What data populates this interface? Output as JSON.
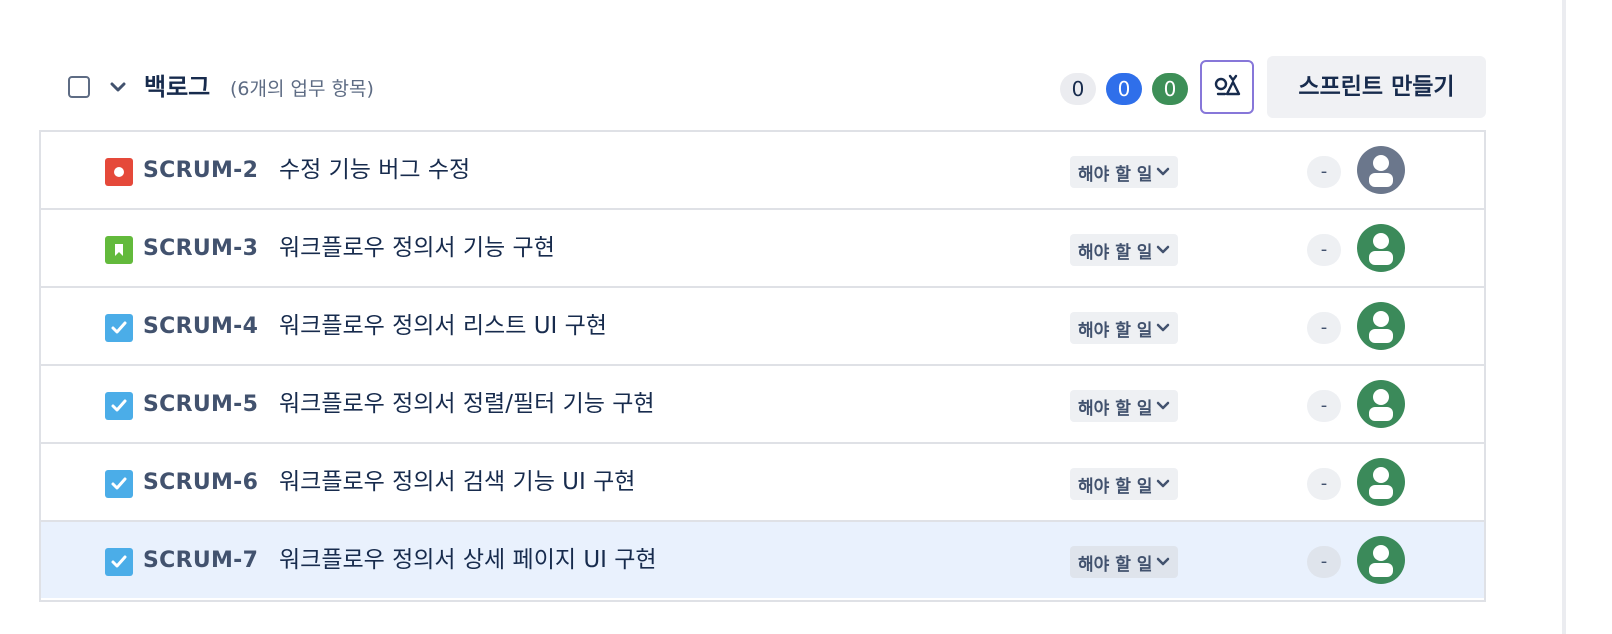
{
  "backlog": {
    "title": "백로그",
    "count_text": "(6개의 업무 항목)",
    "status_counts": {
      "todo": "0",
      "in_progress": "0",
      "done": "0"
    },
    "create_sprint_label": "스프린트 만들기"
  },
  "issues": [
    {
      "key": "SCRUM-2",
      "summary": "수정 기능 버그 수정",
      "type": "bug",
      "status": "해야 할 일",
      "estimate": "-",
      "assignee_color": "#6b778c"
    },
    {
      "key": "SCRUM-3",
      "summary": "워크플로우 정의서 기능 구현",
      "type": "story",
      "status": "해야 할 일",
      "estimate": "-",
      "assignee_color": "#3b8a5a"
    },
    {
      "key": "SCRUM-4",
      "summary": "워크플로우 정의서 리스트 UI 구현",
      "type": "task",
      "status": "해야 할 일",
      "estimate": "-",
      "assignee_color": "#3b8a5a"
    },
    {
      "key": "SCRUM-5",
      "summary": "워크플로우 정의서 정렬/필터 기능 구현",
      "type": "task",
      "status": "해야 할 일",
      "estimate": "-",
      "assignee_color": "#3b8a5a"
    },
    {
      "key": "SCRUM-6",
      "summary": "워크플로우 정의서 검색 기능 UI 구현",
      "type": "task",
      "status": "해야 할 일",
      "estimate": "-",
      "assignee_color": "#3b8a5a"
    },
    {
      "key": "SCRUM-7",
      "summary": "워크플로우 정의서 상세 페이지 UI 구현",
      "type": "task",
      "status": "해야 할 일",
      "estimate": "-",
      "assignee_color": "#3b8a5a"
    }
  ],
  "colors": {
    "bug": "#e5493a",
    "story": "#63ba3c",
    "task": "#4bade8",
    "in_progress_pill": "#2f6fea",
    "done_pill": "#3d8f57",
    "insights_border": "#8777d9",
    "selected_row": "#e9f1fd"
  },
  "icons": {
    "select": "checkbox",
    "collapse": "chevron-down-icon",
    "insights": "insights-icon",
    "bug": "bug-icon",
    "story": "story-icon",
    "task": "task-icon",
    "avatar": "person-icon"
  }
}
